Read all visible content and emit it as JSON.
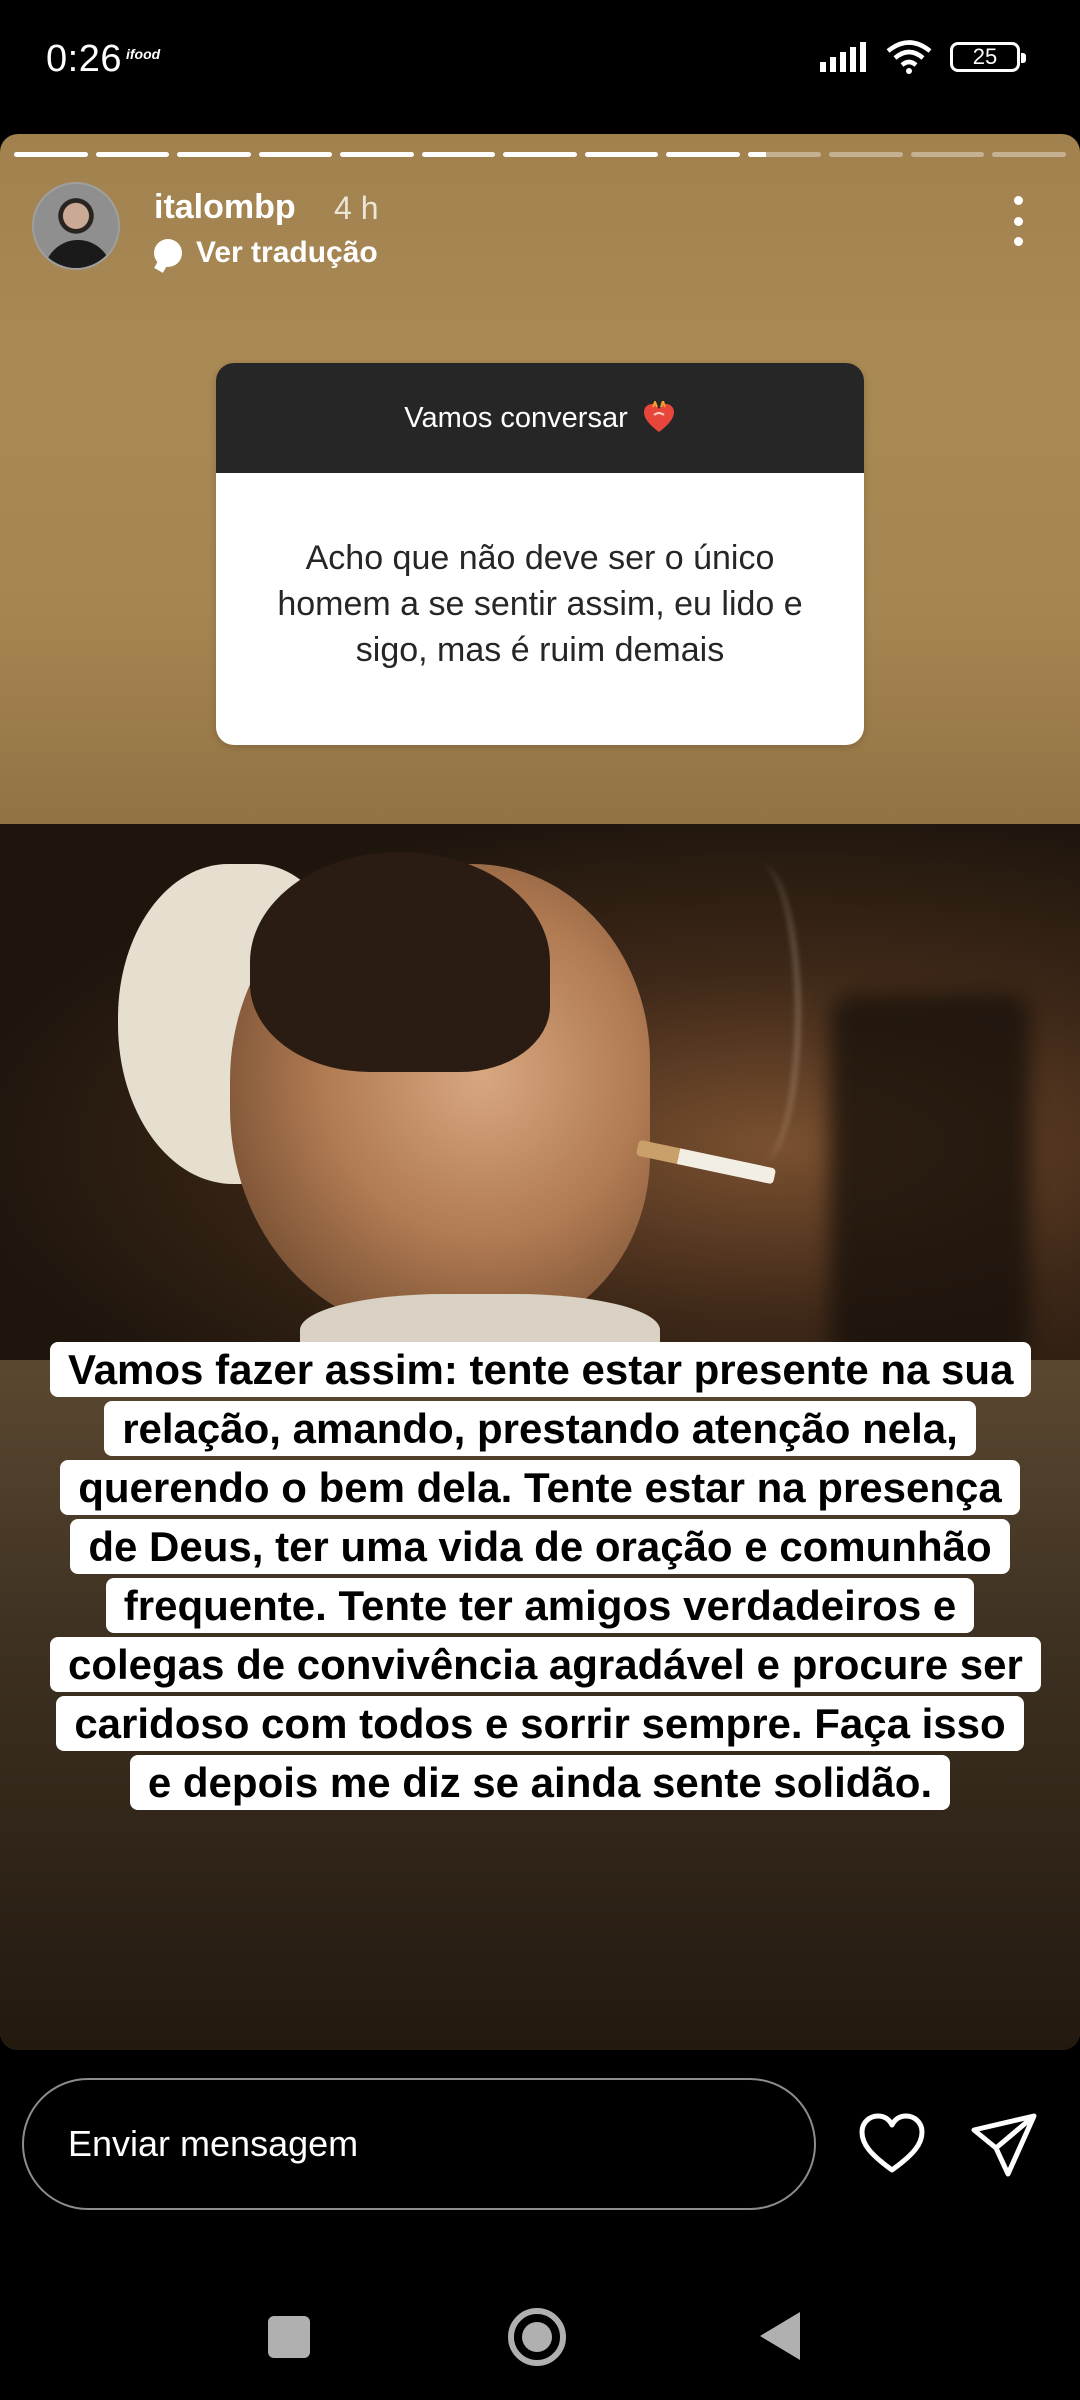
{
  "status_bar": {
    "time": "0:26",
    "app_badge": "ifood",
    "battery": "25"
  },
  "story": {
    "progress": {
      "segments": 13,
      "completed": 9,
      "current_fill": 0.25
    },
    "header": {
      "username": "italombp",
      "time_ago": "4 h",
      "translate_label": "Ver tradução"
    },
    "question": {
      "title": "Vamos conversar",
      "body": "Acho que não deve ser o único homem a se sentir assim, eu lido e sigo, mas é ruim demais",
      "heart_color": "#e8463b"
    },
    "caption": "Vamos fazer assim: tente estar presente na sua relação, amando, prestando atenção nela, querendo o bem dela. Tente estar na presença de Deus, ter uma vida de oração e comunhão frequente. Tente ter amigos verdadeiros e colegas de convivência agradável e procure ser caridoso com todos e sorrir sempre. Faça isso e depois me diz se ainda sente solidão."
  },
  "reply_bar": {
    "placeholder": "Enviar mensagem"
  },
  "icons": {
    "like": "heart-outline-icon",
    "send": "paper-plane-icon",
    "more": "more-vertical-icon"
  },
  "colors": {
    "story_top": "#a1814e",
    "story_bottom": "#23190f",
    "sticker_header": "#262626"
  }
}
